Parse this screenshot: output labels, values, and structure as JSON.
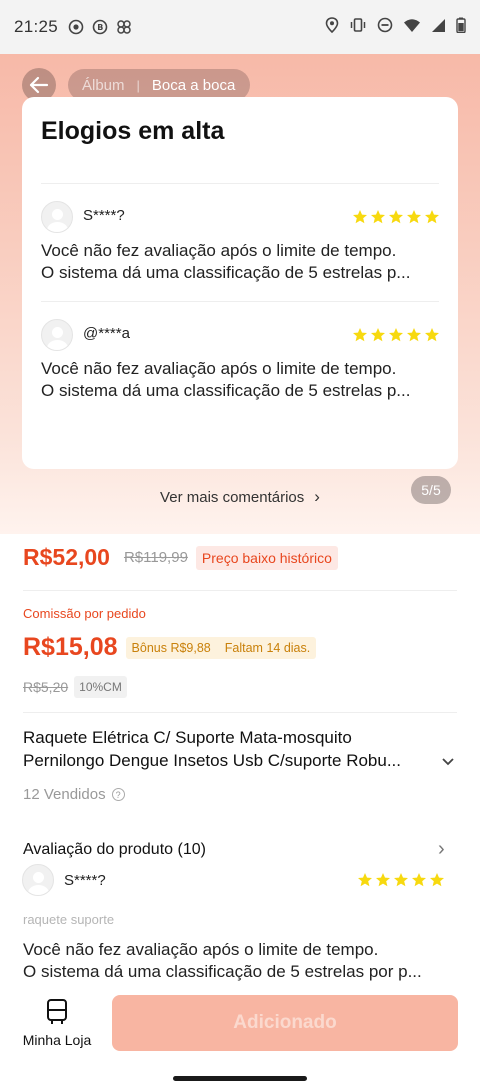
{
  "status_bar": {
    "time": "21:25",
    "icons": [
      "record-icon",
      "b-circle-icon",
      "pinwheel-icon",
      "location-icon",
      "vibrate-icon",
      "dnd-icon",
      "wifi-icon",
      "signal-icon",
      "battery-icon"
    ]
  },
  "header": {
    "breadcrumb": {
      "album": "Álbum",
      "separator": "|",
      "current": "Boca a boca"
    }
  },
  "praise_card": {
    "title": "Elogios em alta",
    "reviews": [
      {
        "user": "S****?",
        "stars": 5,
        "line1": "Você não fez avaliação após o limite de tempo.",
        "line2": "O sistema dá uma classificação de 5 estrelas p..."
      },
      {
        "user": "@****a",
        "stars": 5,
        "line1": "Você não fez avaliação após o limite de tempo.",
        "line2": "O sistema dá uma classificação de 5 estrelas p..."
      }
    ],
    "more_label": "Ver mais comentários",
    "pager": "5/5"
  },
  "pricing": {
    "price": "R$52,00",
    "old_price": "R$119,99",
    "low_tag": "Preço baixo histórico",
    "commission_label": "Comissão por pedido",
    "commission_price": "R$15,08",
    "bonus": "Bônus R$9,88",
    "days_left": "Faltam 14 dias.",
    "commission_old": "R$5,20",
    "commission_rate": "10%CM"
  },
  "product": {
    "title_line1": "Raquete Elétrica C/ Suporte Mata-mosquito",
    "title_line2": "Pernilongo Dengue Insetos Usb C/suporte Robu...",
    "sold": "12 Vendidos"
  },
  "product_rating": {
    "title": "Avaliação do produto (10)",
    "review": {
      "user": "S****?",
      "stars": 5,
      "note": "raquete suporte",
      "line1": "Você não fez avaliação após o limite de tempo.",
      "line2": "O sistema dá uma classificação de 5 estrelas por p..."
    }
  },
  "bottom": {
    "shop_label": "Minha Loja",
    "add_label": "Adicionado"
  },
  "colors": {
    "accent": "#e8471f",
    "star": "#f7d90f",
    "add_button": "#f8b5a2"
  }
}
